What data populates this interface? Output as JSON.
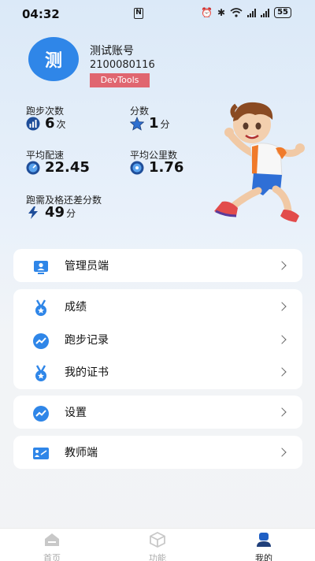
{
  "status_bar": {
    "time": "04:32",
    "nfc": "N",
    "battery": "55"
  },
  "profile": {
    "avatar_text": "测",
    "name": "测试账号",
    "id": "2100080116",
    "devtools": "DevTools"
  },
  "stats": {
    "run_count": {
      "label": "跑步次数",
      "value": "6",
      "unit": "次"
    },
    "score": {
      "label": "分数",
      "value": "1",
      "unit": "分"
    },
    "avg_pace": {
      "label": "平均配速",
      "value": "22.45"
    },
    "avg_km": {
      "label": "平均公里数",
      "value": "1.76"
    },
    "pass_diff": {
      "label": "跑需及格还差分数",
      "value": "49",
      "unit": "分"
    }
  },
  "menu": {
    "admin": {
      "label": "管理员端"
    },
    "grades": {
      "label": "成绩"
    },
    "run_records": {
      "label": "跑步记录"
    },
    "certificate": {
      "label": "我的证书"
    },
    "settings": {
      "label": "设置"
    },
    "teacher": {
      "label": "教师端"
    }
  },
  "nav": {
    "home": "首页",
    "functions": "功能",
    "mine": "我的"
  },
  "colors": {
    "accent": "#2f86e8",
    "devtools_bg": "#e06670"
  }
}
